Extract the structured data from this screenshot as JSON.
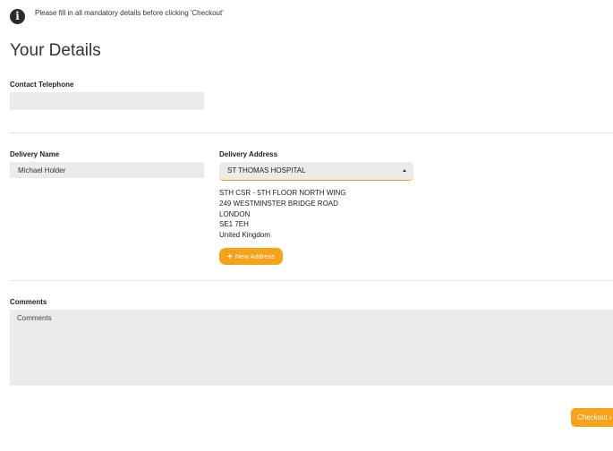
{
  "notice": {
    "icon": "info-icon",
    "icon_glyph": "i",
    "text": "Please fill in all mandatory details before clicking 'Checkout'"
  },
  "page_title": "Your Details",
  "contact_telephone": {
    "label": "Contact Telephone",
    "value": ""
  },
  "delivery_name": {
    "label": "Delivery Name",
    "value": "Michael Holder"
  },
  "delivery_address": {
    "label": "Delivery Address",
    "selected": "ST THOMAS HOSPITAL",
    "lines": [
      "STH CSR - 5TH FLOOR NORTH WING",
      "249 WESTMINSTER BRIDGE ROAD",
      "LONDON",
      "SE1 7EH",
      "United Kingdom"
    ],
    "new_address_label": "New Address",
    "new_address_icon": "plus-icon"
  },
  "comments": {
    "label": "Comments",
    "placeholder": "Comments"
  },
  "checkout": {
    "label": "Checkout",
    "icon": "chevron-right-icon"
  },
  "colors": {
    "accent": "#f7a21b",
    "field_bg": "#ebebeb",
    "divider": "#e6e6e6"
  }
}
